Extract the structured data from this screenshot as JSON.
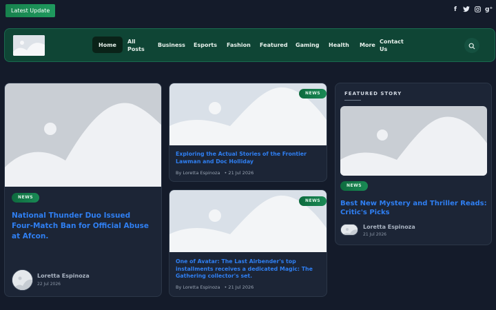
{
  "topbar": {
    "latest_update_label": "Latest Update",
    "socials": [
      {
        "icon": "facebook-icon",
        "glyph": "f"
      },
      {
        "icon": "twitter-icon",
        "glyph": "🐦"
      },
      {
        "icon": "instagram-icon",
        "glyph": "◎"
      },
      {
        "icon": "google-plus-icon",
        "glyph": "g⁺"
      }
    ]
  },
  "nav": {
    "items": [
      {
        "label": "Home"
      },
      {
        "label": "All\nPosts"
      },
      {
        "label": "Business"
      },
      {
        "label": "Esports"
      },
      {
        "label": "Fashion"
      },
      {
        "label": "Featured"
      },
      {
        "label": "Gaming"
      },
      {
        "label": "Health"
      },
      {
        "label": "More"
      },
      {
        "label": "Contact\nUs"
      }
    ]
  },
  "main_post": {
    "badge": "NEWS",
    "title": "National Thunder Duo Issued Four-Match Ban for Official Abuse at Afcon.",
    "author": "Loretta Espinoza",
    "date": "22 Jul 2026"
  },
  "mid_posts": [
    {
      "badge": "NEWS",
      "title": "Exploring the Actual Stories of the Frontier Lawman and Doc Holliday",
      "byline": "By Loretta Espinoza",
      "date": "• 21 Jul 2026"
    },
    {
      "badge": "NEWS",
      "title": "One of Avatar: The Last Airbender's top installments receives a dedicated Magic: The Gathering collector's set.",
      "byline": "By Loretta Espinoza",
      "date": "• 21 Jul 2026"
    }
  ],
  "featured": {
    "heading": "FEATURED STORY",
    "badge": "NEWS",
    "title": "Best New Mystery and Thriller Reads: Critic's Picks",
    "author": "Loretta Espinoza",
    "date": "21 Jul 2026"
  },
  "colors": {
    "page_bg": "#141b2a",
    "nav_bg": "#0f4535",
    "accent_green": "#1a8a55",
    "link_blue": "#2f7ff2"
  }
}
